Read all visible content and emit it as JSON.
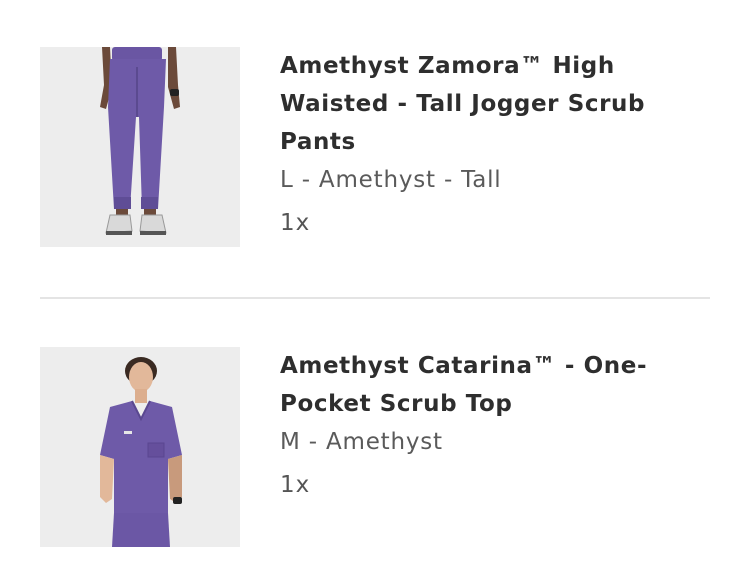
{
  "items": [
    {
      "image": "amethyst-jogger-pants-photo",
      "title": "Amethyst Zamora™ High Waisted - Tall Jogger Scrub Pants",
      "variant": "L - Amethyst - Tall",
      "quantity": "1x"
    },
    {
      "image": "amethyst-scrub-top-photo",
      "title": "Amethyst Catarina™ - One-Pocket Scrub Top",
      "variant": "M - Amethyst",
      "quantity": "1x"
    }
  ],
  "colors": {
    "amethyst": "#6e5aa8",
    "background": "#ffffff",
    "photo_background": "#eeeeee",
    "divider": "#e4e4e4"
  }
}
